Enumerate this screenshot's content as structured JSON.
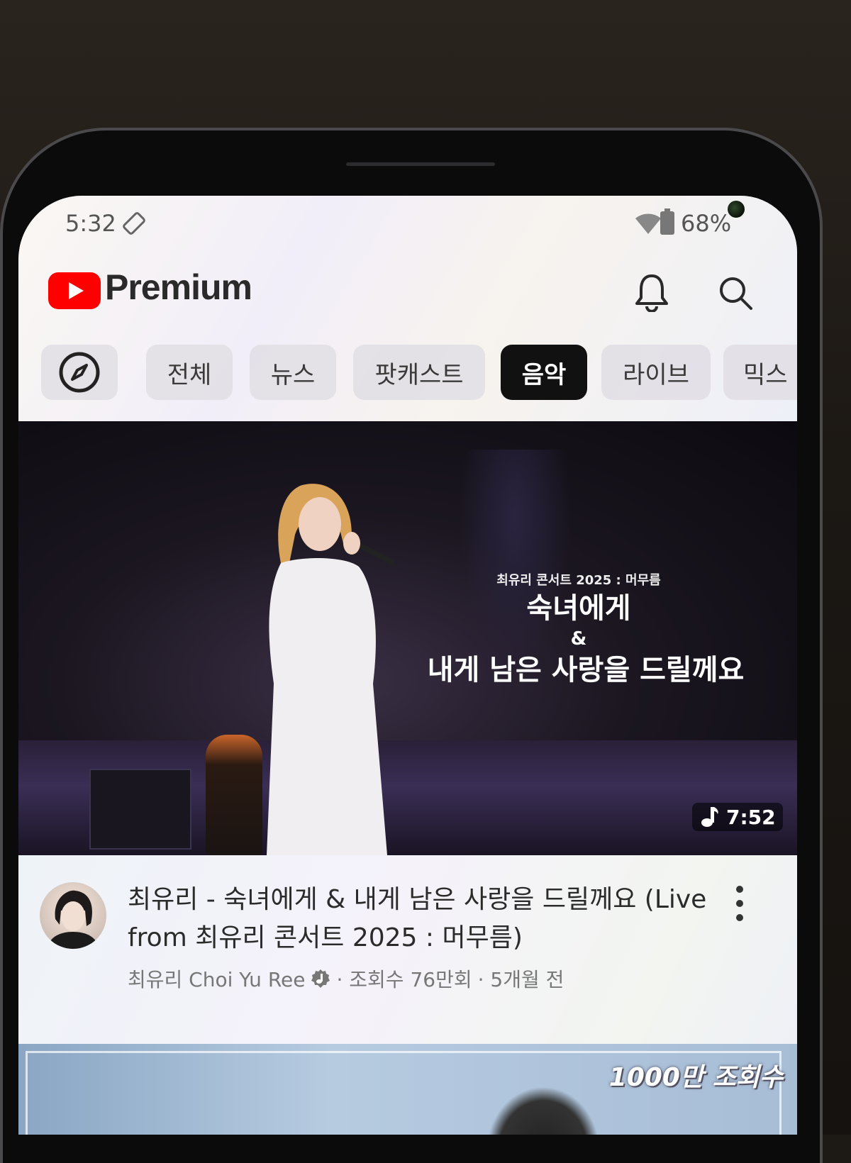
{
  "status_bar": {
    "time": "5:32",
    "battery_percent": "68%"
  },
  "app_bar": {
    "brand": "Premium"
  },
  "chips": [
    {
      "label": "전체"
    },
    {
      "label": "뉴스"
    },
    {
      "label": "팟캐스트"
    },
    {
      "label": "음악",
      "selected": true
    },
    {
      "label": "라이브"
    },
    {
      "label": "믹스"
    }
  ],
  "video": {
    "overlay_small": "최유리 콘서트 2025 : 머무름",
    "overlay_title": "숙녀에게",
    "overlay_amp": "&",
    "overlay_sub": "내게 남은 사랑을 드릴께요",
    "duration": "7:52",
    "title": "최유리 - 숙녀에게 & 내게 남은 사랑을 드릴께요 (Live from 최유리 콘서트 2025 : 머무름)",
    "channel": "최유리 Choi Yu Ree",
    "views": "· 조회수 76만회",
    "age": "· 5개월 전"
  },
  "next_video": {
    "badge": "1000만 조회수"
  },
  "colors": {
    "youtube_red": "#FF0000",
    "chip_active_bg": "#111111",
    "chip_bg": "#E1DEE4"
  }
}
